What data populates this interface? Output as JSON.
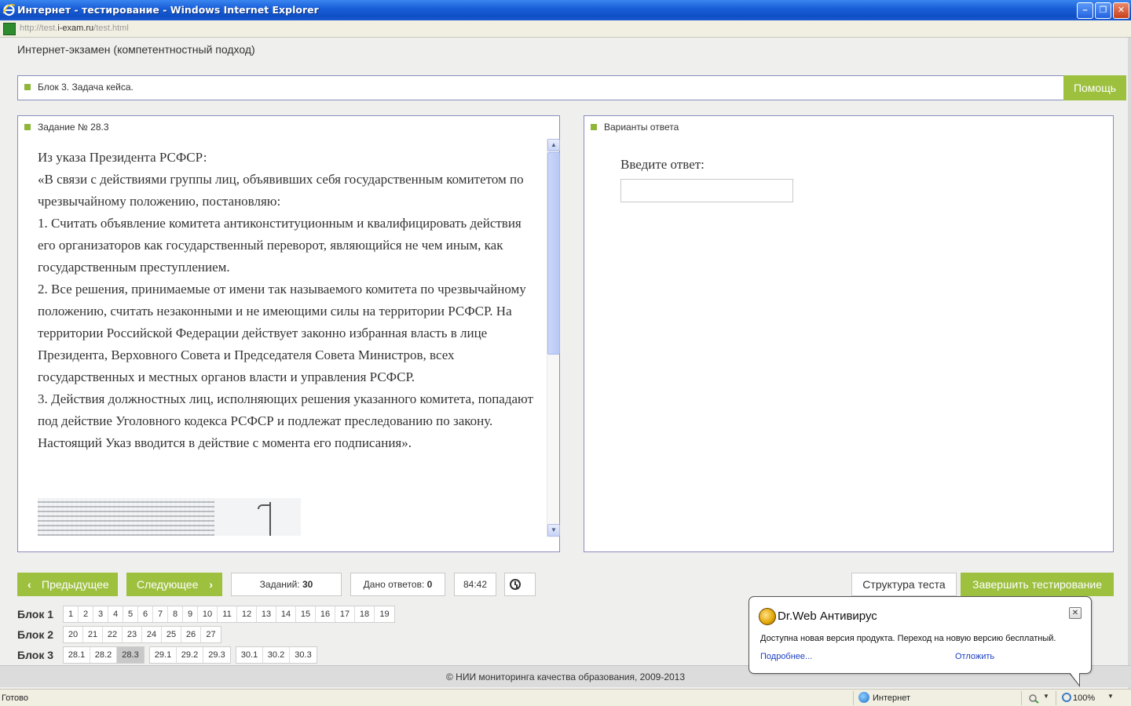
{
  "window": {
    "title": "Интернет - тестирование - Windows Internet Explorer",
    "url_prefix": "http://test.",
    "url_domain": "i-exam.ru",
    "url_path": "/test.html",
    "minimize": "–",
    "restore": "❐",
    "close": "✕"
  },
  "page": {
    "title": "Интернет-экзамен (компетентностный подход)",
    "block_label": "Блок 3. Задача кейса.",
    "help_button": "Помощь"
  },
  "task": {
    "heading": "Задание № 28.3",
    "lines": [
      "Из указа Президента РСФСР:",
      "«В связи с действиями группы лиц, объявивших себя государственным комитетом по чрезвычайному положению, постановляю:",
      "1. Считать объявление комитета антиконституционным и квалифицировать действия его организаторов как государственный переворот, являющийся не чем иным, как государственным преступлением.",
      "2. Все решения, принимаемые от имени так называемого комитета по чрезвычайному положению, считать незаконными и не имеющими силы на территории РСФСР. На территории Российской Федерации действует законно избранная власть в лице Президента, Верховного Совета и Председателя Совета Министров, всех государственных и местных органов власти и управления РСФСР.",
      "3. Действия должностных лиц, исполняющих решения указанного комитета, попадают под действие Уголовного кодекса РСФСР и подлежат преследованию по закону.",
      "Настоящий Указ вводится в действие с момента его подписания»."
    ]
  },
  "answer": {
    "heading": "Варианты ответа",
    "prompt": "Введите ответ:",
    "value": ""
  },
  "nav": {
    "prev_label": "Предыдущее",
    "next_label": "Следующее",
    "tasks_label": "Заданий:",
    "tasks_count": "30",
    "answers_label": "Дано ответов:",
    "answers_count": "0",
    "timer": "84:42",
    "structure_label": "Структура теста",
    "finish_label": "Завершить тестирование"
  },
  "blocks": [
    {
      "label": "Блок 1",
      "groups": [
        [
          "1",
          "2",
          "3",
          "4",
          "5",
          "6",
          "7",
          "8",
          "9",
          "10",
          "11",
          "12",
          "13",
          "14",
          "15",
          "16",
          "17",
          "18",
          "19"
        ]
      ]
    },
    {
      "label": "Блок 2",
      "groups": [
        [
          "20",
          "21",
          "22",
          "23",
          "24",
          "25",
          "26",
          "27"
        ]
      ]
    },
    {
      "label": "Блок 3",
      "groups": [
        [
          "28.1",
          "28.2",
          "28.3"
        ],
        [
          "29.1",
          "29.2",
          "29.3"
        ],
        [
          "30.1",
          "30.2",
          "30.3"
        ]
      ]
    }
  ],
  "active_question": "28.3",
  "footer": "© НИИ мониторинга качества образования, 2009-2013",
  "status": {
    "ready": "Готово",
    "zone": "Интернет",
    "zoom": "100%"
  },
  "notification": {
    "title": "Dr.Web Антивирус",
    "message": "Доступна новая версия продукта. Переход на новую версию бесплатный.",
    "more_link": "Подробнее...",
    "postpone_link": "Отложить",
    "close": "✕"
  },
  "colors": {
    "accent_green": "#9dc03f",
    "titlebar_blue": "#1a5fd8",
    "panel_border": "#8c8cbd"
  }
}
